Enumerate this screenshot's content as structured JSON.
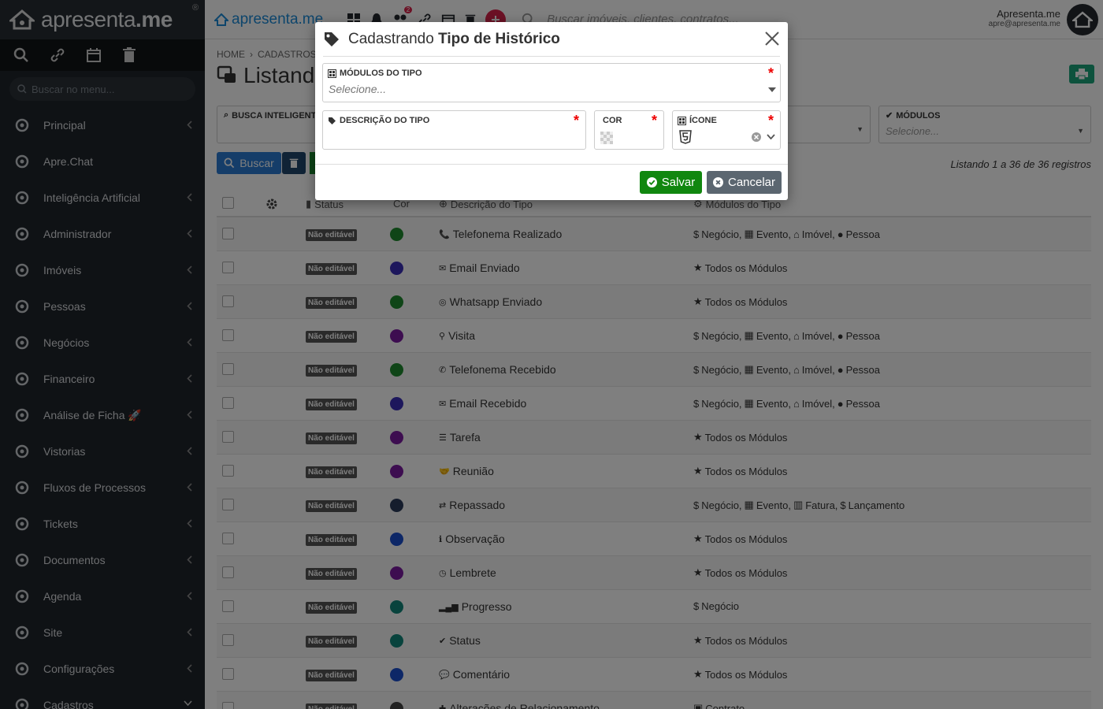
{
  "sidebar": {
    "brand": "apresenta",
    "brand_suffix": ".me",
    "reg_mark": "®",
    "search_placeholder": "Buscar no menu...",
    "items": [
      {
        "label": "Principal",
        "icon": "grid-icon",
        "chevron": "left"
      },
      {
        "label": "Apre.Chat",
        "icon": "whatsapp-icon",
        "chevron": ""
      },
      {
        "label": "Inteligência Artificial",
        "icon": "robot-icon",
        "chevron": "left"
      },
      {
        "label": "Administrador",
        "icon": "user-tie-icon",
        "chevron": "left"
      },
      {
        "label": "Imóveis",
        "icon": "home-icon",
        "chevron": "left"
      },
      {
        "label": "Pessoas",
        "icon": "people-icon",
        "chevron": "left"
      },
      {
        "label": "Negócios",
        "icon": "handshake-icon",
        "chevron": "left"
      },
      {
        "label": "Financeiro",
        "icon": "dollar-icon",
        "chevron": "left"
      },
      {
        "label": "Análise de Ficha 🚀",
        "icon": "user-check-icon",
        "chevron": "left"
      },
      {
        "label": "Vistorias",
        "icon": "user-search-icon",
        "chevron": "left"
      },
      {
        "label": "Fluxos de Processos",
        "icon": "filter-icon",
        "chevron": "left"
      },
      {
        "label": "Tickets",
        "icon": "headset-icon",
        "chevron": "left"
      },
      {
        "label": "Documentos",
        "icon": "document-icon",
        "chevron": "left"
      },
      {
        "label": "Agenda",
        "icon": "calendar-clock-icon",
        "chevron": "left"
      },
      {
        "label": "Site",
        "icon": "browser-icon",
        "chevron": "left"
      },
      {
        "label": "Configurações",
        "icon": "gears-icon",
        "chevron": "left"
      },
      {
        "label": "Cadastros",
        "icon": "plus-circle-icon",
        "chevron": "down"
      }
    ]
  },
  "topbar": {
    "brand": "apresenta.me",
    "notif_count": "2",
    "search_placeholder": "Buscar imóveis, clientes, contratos...",
    "user_name": "Apresenta.me",
    "user_email": "apre@apresenta.me"
  },
  "main": {
    "breadcrumb": [
      "HOME",
      "CADASTROS"
    ],
    "title": "Listando",
    "filter_smart": "BUSCA INTELIGENTE",
    "filter_modules": "MÓDULOS",
    "filter_modules_placeholder": "Selecione...",
    "btn_buscar": "Buscar",
    "record_count": "Listando 1 a 36 de 36 registros",
    "columns": {
      "status": "Status",
      "cor": "Cor",
      "descricao": "Descrição do Tipo",
      "modulos": "Módulos do Tipo"
    },
    "rows": [
      {
        "badge": "Não editável",
        "color": "#1e8a2e",
        "icon": "phone-icon",
        "glyph": "📞",
        "desc": "Telefonema Realizado",
        "mods": "neg-ev-im-pes"
      },
      {
        "badge": "Não editável",
        "color": "#3a2fb8",
        "icon": "envelope-icon",
        "glyph": "✉",
        "desc": "Email Enviado",
        "mods": "todos"
      },
      {
        "badge": "Não editável",
        "color": "#1e8a2e",
        "icon": "whatsapp-icon",
        "glyph": "◎",
        "desc": "Whatsapp Enviado",
        "mods": "todos"
      },
      {
        "badge": "Não editável",
        "color": "#7a1aa0",
        "icon": "map-pin-icon",
        "glyph": "⚲",
        "desc": "Visita",
        "mods": "neg-ev-im-pes"
      },
      {
        "badge": "Não editável",
        "color": "#1e8a2e",
        "icon": "phone-in-icon",
        "glyph": "✆",
        "desc": "Telefonema Recebido",
        "mods": "neg-ev-im-pes"
      },
      {
        "badge": "Não editável",
        "color": "#3a2fb8",
        "icon": "envelope-open-icon",
        "glyph": "✉",
        "desc": "Email Recebido",
        "mods": "neg-ev-im-pes"
      },
      {
        "badge": "Não editável",
        "color": "#7a1aa0",
        "icon": "tasks-icon",
        "glyph": "☰",
        "desc": "Tarefa",
        "mods": "todos"
      },
      {
        "badge": "Não editável",
        "color": "#7a1aa0",
        "icon": "handshake-icon",
        "glyph": "🤝",
        "desc": "Reunião",
        "mods": "todos"
      },
      {
        "badge": "Não editável",
        "color": "#2a3a5a",
        "icon": "exchange-icon",
        "glyph": "⇄",
        "desc": "Repassado",
        "mods": "neg-ev-fat-lan"
      },
      {
        "badge": "Não editável",
        "color": "#1a4fcf",
        "icon": "info-icon",
        "glyph": "ℹ",
        "desc": "Observação",
        "mods": "todos"
      },
      {
        "badge": "Não editável",
        "color": "#7a1aa0",
        "icon": "clock-icon",
        "glyph": "◷",
        "desc": "Lembrete",
        "mods": "todos"
      },
      {
        "badge": "Não editável",
        "color": "#11877a",
        "icon": "signal-icon",
        "glyph": "▂▄▆",
        "desc": "Progresso",
        "mods": "neg"
      },
      {
        "badge": "Não editável",
        "color": "#11877a",
        "icon": "check-circle-icon",
        "glyph": "✔",
        "desc": "Status",
        "mods": "todos"
      },
      {
        "badge": "Não editável",
        "color": "#1a4fcf",
        "icon": "comment-icon",
        "glyph": "💬",
        "desc": "Comentário",
        "mods": "todos"
      },
      {
        "badge": "Não editável",
        "color": "#444",
        "icon": "plus-icon",
        "glyph": "✚",
        "desc": "Alterações de Relacionamento",
        "mods": "contrato"
      }
    ],
    "mod_labels": {
      "negocio": "Negócio,",
      "negocio_only": "Negócio",
      "evento": "Evento,",
      "imovel": "Imóvel,",
      "pessoa": "Pessoa",
      "todos": "Todos os Módulos",
      "fatura": "Fatura,",
      "lancamento": "Lançamento",
      "contrato": "Contrato"
    }
  },
  "modal": {
    "title_prefix": "Cadastrando",
    "title_bold": "Tipo de Histórico",
    "field_modulos_label": "MÓDULOS DO TIPO",
    "field_modulos_placeholder": "Selecione...",
    "field_descricao_label": "DESCRIÇÃO DO TIPO",
    "field_cor_label": "COR",
    "field_icone_label": "ÍCONE",
    "required_mark": "*",
    "btn_salvar": "Salvar",
    "btn_cancelar": "Cancelar"
  }
}
